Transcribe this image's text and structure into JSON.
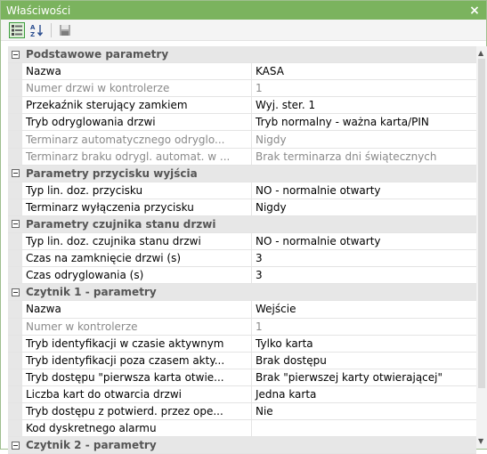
{
  "window": {
    "title": "Właściwości",
    "close": "×"
  },
  "toolbar": {
    "categorized_icon": "categorized-view-icon",
    "alphabetical_icon": "sort-az-icon",
    "pages_icon": "property-pages-icon"
  },
  "categories": [
    {
      "label": "Podstawowe parametry",
      "rows": [
        {
          "name": "Nazwa",
          "value": "KASA",
          "readonly": false
        },
        {
          "name": "Numer drzwi w kontrolerze",
          "value": "1",
          "readonly": true
        },
        {
          "name": "Przekaźnik sterujący zamkiem",
          "value": "Wyj. ster. 1",
          "readonly": false
        },
        {
          "name": "Tryb odryglowania drzwi",
          "value": "Tryb normalny - ważna karta/PIN",
          "readonly": false
        },
        {
          "name": "Terminarz automatycznego odryglo...",
          "value": "Nigdy",
          "readonly": true
        },
        {
          "name": "Terminarz braku odrygl. automat. w ...",
          "value": "Brak  terminarza dni świątecznych",
          "readonly": true
        }
      ]
    },
    {
      "label": "Parametry przycisku wyjścia",
      "rows": [
        {
          "name": "Typ lin. doz. przycisku",
          "value": "NO - normalnie otwarty",
          "readonly": false
        },
        {
          "name": "Terminarz wyłączenia przycisku",
          "value": "Nigdy",
          "readonly": false
        }
      ]
    },
    {
      "label": "Parametry czujnika stanu drzwi",
      "rows": [
        {
          "name": "Typ lin. doz. czujnika stanu drzwi",
          "value": "NO - normalnie otwarty",
          "readonly": false
        },
        {
          "name": "Czas na zamknięcie drzwi (s)",
          "value": "3",
          "readonly": false
        },
        {
          "name": "Czas odryglowania (s)",
          "value": "3",
          "readonly": false
        }
      ]
    },
    {
      "label": "Czytnik 1 - parametry",
      "rows": [
        {
          "name": "Nazwa",
          "value": "Wejście",
          "readonly": false
        },
        {
          "name": "Numer w kontrolerze",
          "value": "1",
          "readonly": true
        },
        {
          "name": "Tryb identyfikacji w czasie aktywnym",
          "value": "Tylko karta",
          "readonly": false
        },
        {
          "name": "Tryb identyfikacji poza czasem akty...",
          "value": "Brak dostępu",
          "readonly": false
        },
        {
          "name": "Tryb dostępu \"pierwsza karta otwie...",
          "value": "Brak \"pierwszej karty otwierającej\"",
          "readonly": false
        },
        {
          "name": "Liczba kart do otwarcia drzwi",
          "value": "Jedna karta",
          "readonly": false
        },
        {
          "name": "Tryb dostępu z potwierd. przez ope...",
          "value": "Nie",
          "readonly": false
        },
        {
          "name": "Kod dyskretnego alarmu",
          "value": "",
          "readonly": false
        }
      ]
    },
    {
      "label": "Czytnik 2 - parametry",
      "rows": []
    }
  ]
}
